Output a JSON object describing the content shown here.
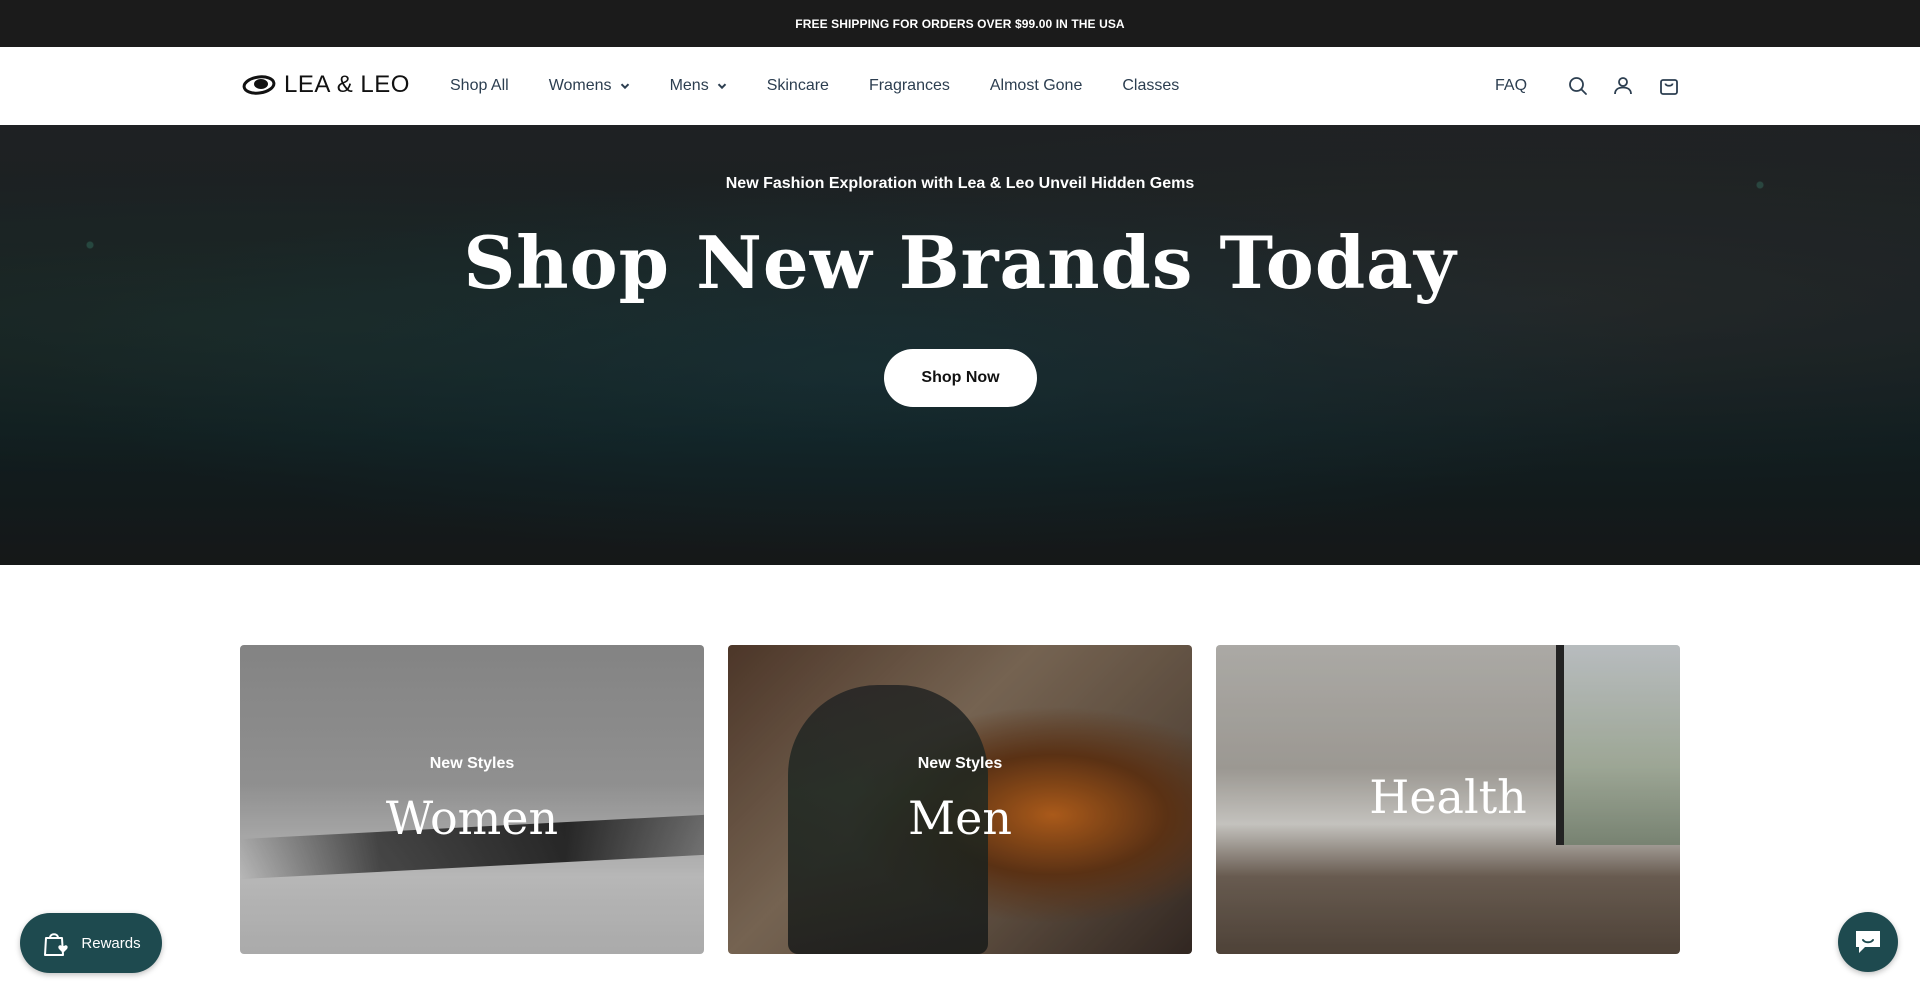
{
  "announcement": {
    "text": "FREE SHIPPING FOR ORDERS OVER $99.00 IN THE USA"
  },
  "header": {
    "logo_text": "LEA & LEO",
    "nav": [
      {
        "label": "Shop All",
        "has_dropdown": false
      },
      {
        "label": "Womens",
        "has_dropdown": true
      },
      {
        "label": "Mens",
        "has_dropdown": true
      },
      {
        "label": "Skincare",
        "has_dropdown": false
      },
      {
        "label": "Fragrances",
        "has_dropdown": false
      },
      {
        "label": "Almost Gone",
        "has_dropdown": false
      },
      {
        "label": "Classes",
        "has_dropdown": false
      }
    ],
    "faq_label": "FAQ",
    "icons": [
      "search-icon",
      "account-icon",
      "cart-icon"
    ]
  },
  "hero": {
    "subtitle": "New Fashion Exploration with Lea & Leo Unveil Hidden Gems",
    "title": "Shop New Brands Today",
    "button_label": "Shop Now"
  },
  "collections": [
    {
      "subtitle": "New Styles",
      "title": "Women"
    },
    {
      "subtitle": "New Styles",
      "title": "Men"
    },
    {
      "subtitle": "",
      "title": "Health"
    }
  ],
  "widgets": {
    "rewards_label": "Rewards",
    "chat_icon": "chat-icon"
  },
  "colors": {
    "announcement_bg": "#1b1b1b",
    "widget_bg": "#1e4a4f",
    "nav_text": "#2c3e50"
  }
}
